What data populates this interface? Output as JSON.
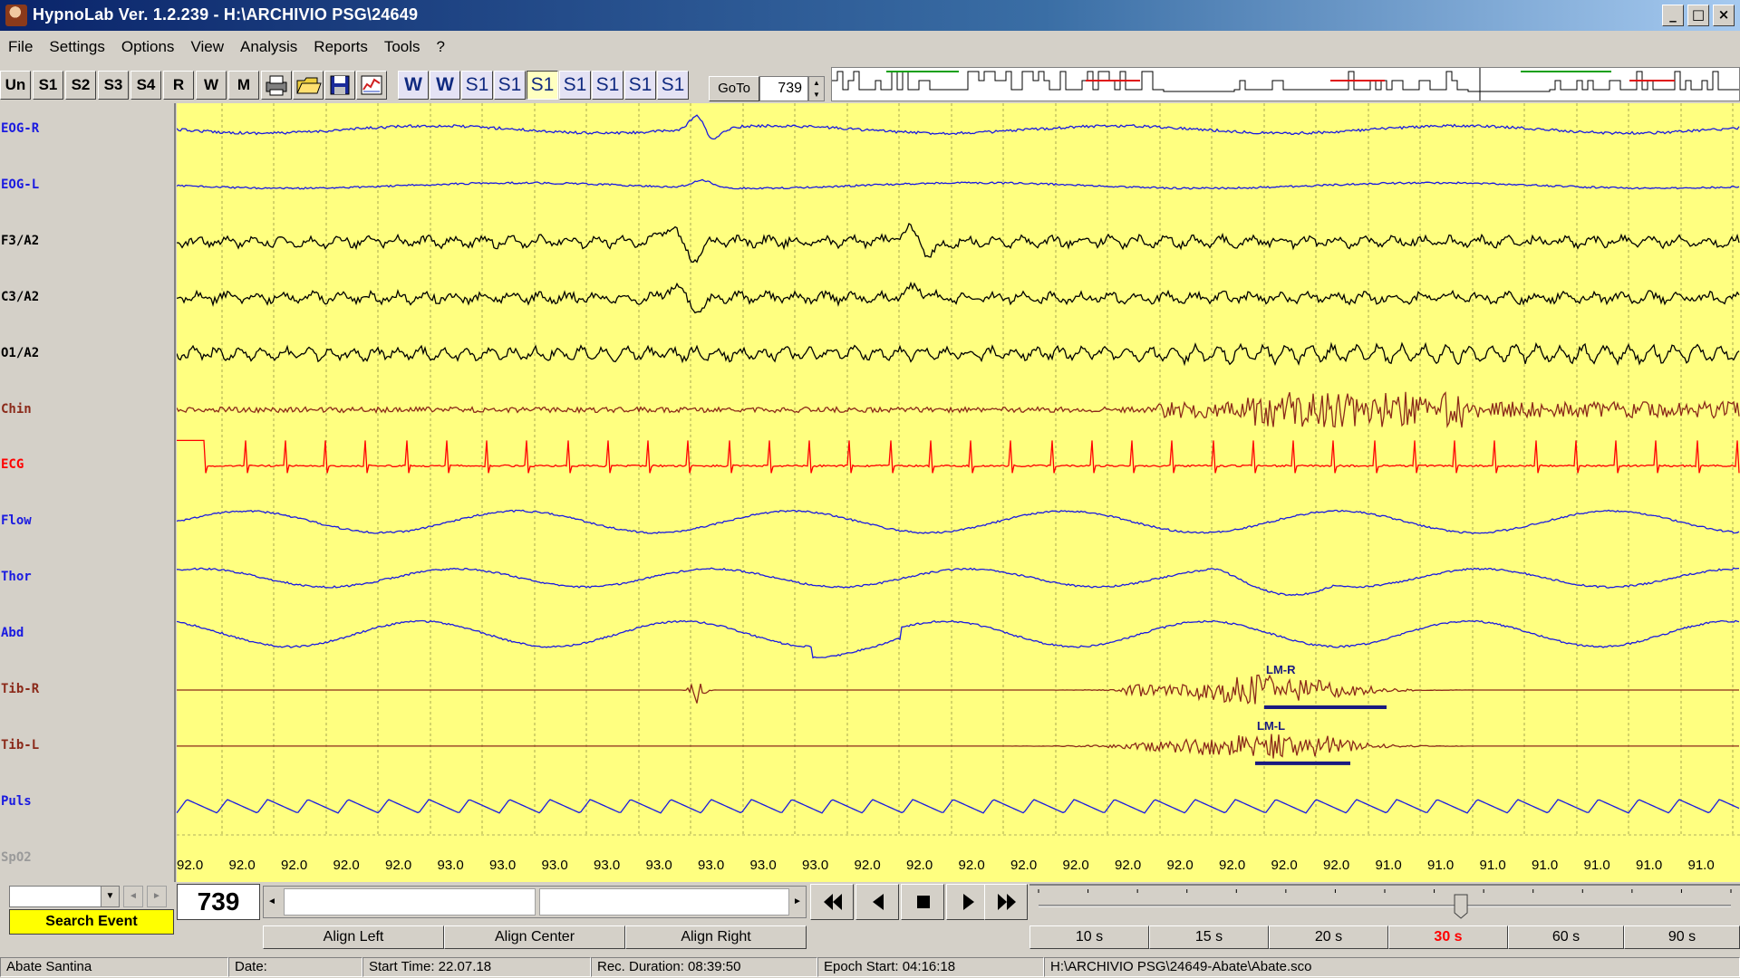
{
  "window": {
    "title": "HypnoLab Ver. 1.2.239 - H:\\ARCHIVIO PSG\\24649",
    "minimize": "_",
    "maximize": "□",
    "close": "×"
  },
  "menu": [
    "File",
    "Settings",
    "Options",
    "View",
    "Analysis",
    "Reports",
    "Tools",
    "?"
  ],
  "toolbar": {
    "stage_buttons": [
      "Un",
      "S1",
      "S2",
      "S3",
      "S4",
      "R",
      "W",
      "M"
    ],
    "hypnogram_stages": [
      "W",
      "W",
      "S1",
      "S1",
      "S1",
      "S1",
      "S1",
      "S1",
      "S1"
    ],
    "active_stage_index": 4,
    "goto_label": "GoTo",
    "goto_value": "739",
    "spin_up": "▲",
    "spin_down": "▼"
  },
  "channels": [
    {
      "name": "EOG-R",
      "color": "#1a1ae0"
    },
    {
      "name": "EOG-L",
      "color": "#1a1ae0"
    },
    {
      "name": "F3/A2",
      "color": "#000000"
    },
    {
      "name": "C3/A2",
      "color": "#000000"
    },
    {
      "name": "O1/A2",
      "color": "#000000"
    },
    {
      "name": "Chin",
      "color": "#8b2a1a"
    },
    {
      "name": "ECG",
      "color": "#ff0000"
    },
    {
      "name": "Flow",
      "color": "#1a1ae0"
    },
    {
      "name": "Thor",
      "color": "#1a1ae0"
    },
    {
      "name": "Abd",
      "color": "#1a1ae0"
    },
    {
      "name": "Tib-R",
      "color": "#8b2a1a"
    },
    {
      "name": "Tib-L",
      "color": "#8b2a1a"
    },
    {
      "name": "Puls",
      "color": "#1a1ae0"
    },
    {
      "name": "SpO2",
      "color": "#9a9a9a"
    }
  ],
  "events": [
    {
      "label": "LM-R",
      "channel": "Tib-R"
    },
    {
      "label": "LM-L",
      "channel": "Tib-L"
    }
  ],
  "spo2_values": [
    "92.0",
    "92.0",
    "92.0",
    "92.0",
    "92.0",
    "93.0",
    "93.0",
    "93.0",
    "93.0",
    "93.0",
    "93.0",
    "93.0",
    "93.0",
    "92.0",
    "92.0",
    "92.0",
    "92.0",
    "92.0",
    "92.0",
    "92.0",
    "92.0",
    "92.0",
    "92.0",
    "91.0",
    "91.0",
    "91.0",
    "91.0",
    "91.0",
    "91.0",
    "91.0"
  ],
  "bottom": {
    "search_event": "Search Event",
    "epoch": "739",
    "align_left": "Align Left",
    "align_center": "Align Center",
    "align_right": "Align Right",
    "scroll_left": "◄",
    "scroll_right": "►",
    "combo_arrow": "▼",
    "time_buttons": [
      "10 s",
      "15 s",
      "20 s",
      "30 s",
      "60 s",
      "90 s"
    ],
    "active_time_index": 3,
    "slider_value": 0.61
  },
  "status": {
    "patient": "Abate Santina",
    "date": "Date:",
    "start_time": "Start Time: 22.07.18",
    "duration": "Rec. Duration: 08:39:50",
    "epoch_start": "Epoch Start: 04:16:18",
    "file": "H:\\ARCHIVIO PSG\\24649-Abate\\Abate.sco"
  },
  "colors": {
    "plot_bg": "#ffff80",
    "event_bar": "#1a1a80",
    "hypno_red": "#e01010",
    "hypno_green": "#10a010"
  }
}
